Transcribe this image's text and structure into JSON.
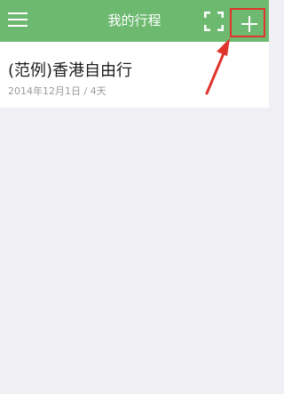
{
  "header": {
    "title": "我的行程",
    "menu_icon": "menu-icon",
    "scan_icon": "scan-icon",
    "add_icon": "plus-icon",
    "background": "#6cb96f"
  },
  "trips": [
    {
      "title": "(范例)香港自由行",
      "meta": "2014年12月1日 / 4天"
    }
  ],
  "annotation": {
    "highlight_color": "#e0342c",
    "target": "add-button"
  },
  "colors": {
    "page_background": "#efeff4",
    "card_background": "#ffffff",
    "meta_text": "#9a9a9a"
  }
}
